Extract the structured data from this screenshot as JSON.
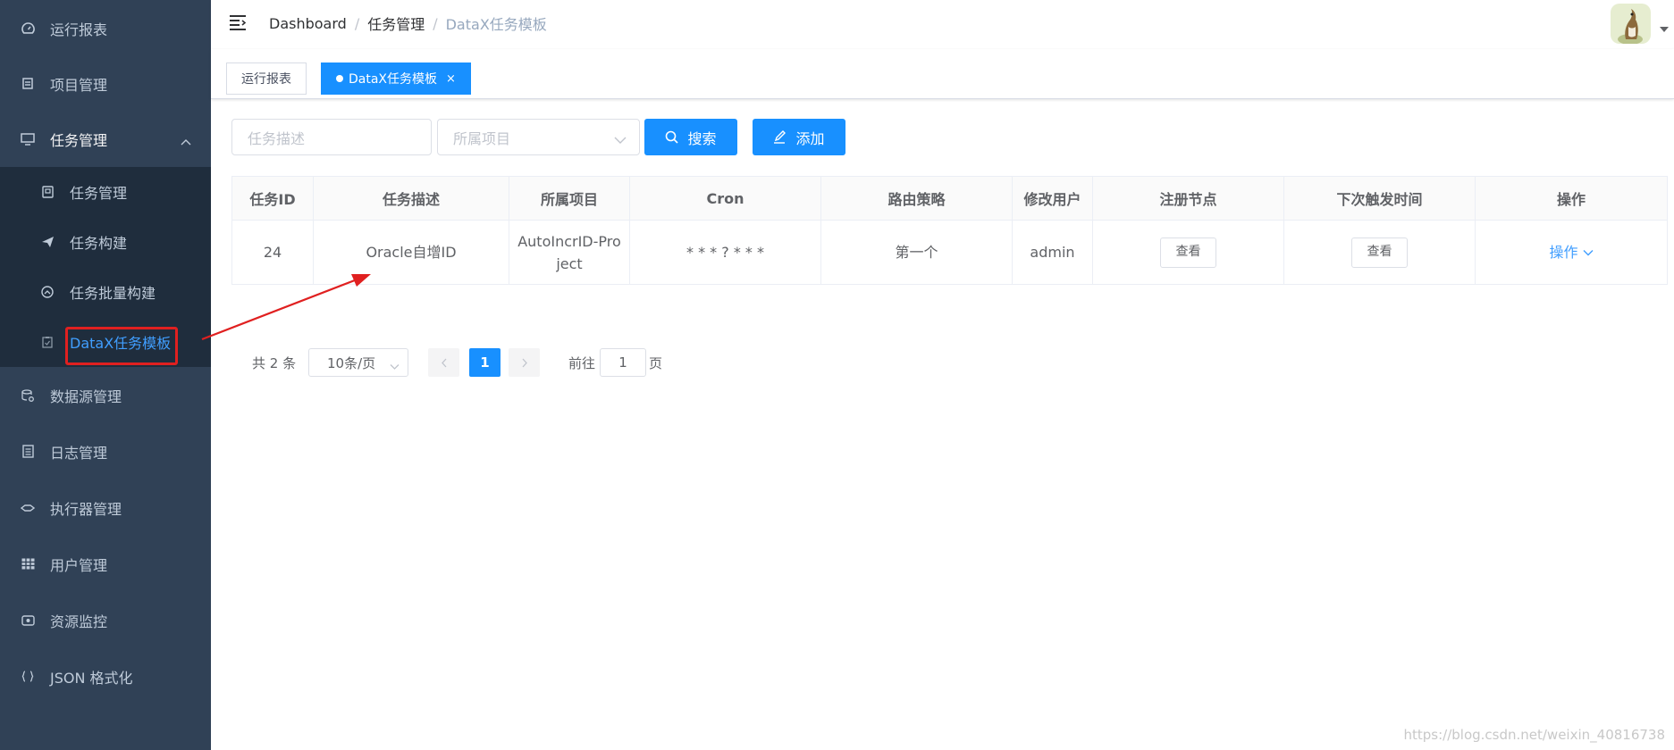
{
  "sidebar": {
    "items": [
      {
        "label": "运行报表",
        "icon": "dashboard-icon"
      },
      {
        "label": "项目管理",
        "icon": "project-icon"
      },
      {
        "label": "任务管理",
        "icon": "monitor-icon"
      },
      {
        "label": "数据源管理",
        "icon": "database-icon"
      },
      {
        "label": "日志管理",
        "icon": "log-icon"
      },
      {
        "label": "执行器管理",
        "icon": "executor-icon"
      },
      {
        "label": "用户管理",
        "icon": "table-icon"
      },
      {
        "label": "资源监控",
        "icon": "monitor-resource-icon"
      },
      {
        "label": "JSON 格式化",
        "icon": "json-icon"
      }
    ],
    "submenu": [
      {
        "label": "任务管理",
        "icon": "task-icon"
      },
      {
        "label": "任务构建",
        "icon": "send-icon"
      },
      {
        "label": "任务批量构建",
        "icon": "batch-icon"
      },
      {
        "label": "DataX任务模板",
        "icon": "template-icon"
      }
    ],
    "active_color": "#409eff",
    "background": "#304156"
  },
  "breadcrumb": [
    "Dashboard",
    "/",
    "任务管理",
    "/",
    "DataX任务模板"
  ],
  "tags": [
    {
      "label": "运行报表"
    },
    {
      "label": "DataX任务模板",
      "close": "×"
    }
  ],
  "filters": {
    "desc_placeholder": "任务描述",
    "project_placeholder": "所属项目",
    "search_label": "搜索",
    "add_label": "添加"
  },
  "table": {
    "headers": [
      "任务ID",
      "任务描述",
      "所属项目",
      "Cron",
      "路由策略",
      "修改用户",
      "注册节点",
      "下次触发时间",
      "操作"
    ],
    "rows": [
      {
        "id": "24",
        "desc": "Oracle自增ID",
        "project": "AutoIncrID-Project",
        "cron": "* * * ? * * *",
        "route": "第一个",
        "user": "admin",
        "nodes_btn": "查看",
        "next_btn": "查看",
        "op": "操作"
      }
    ]
  },
  "pagination": {
    "total": "共 2 条",
    "page_size": "10条/页",
    "current_page": "1",
    "goto_label": "前往",
    "goto_value": "1",
    "page_suffix": "页"
  },
  "watermark": "https://blog.csdn.net/weixin_40816738",
  "accent_color": "#1890ff"
}
